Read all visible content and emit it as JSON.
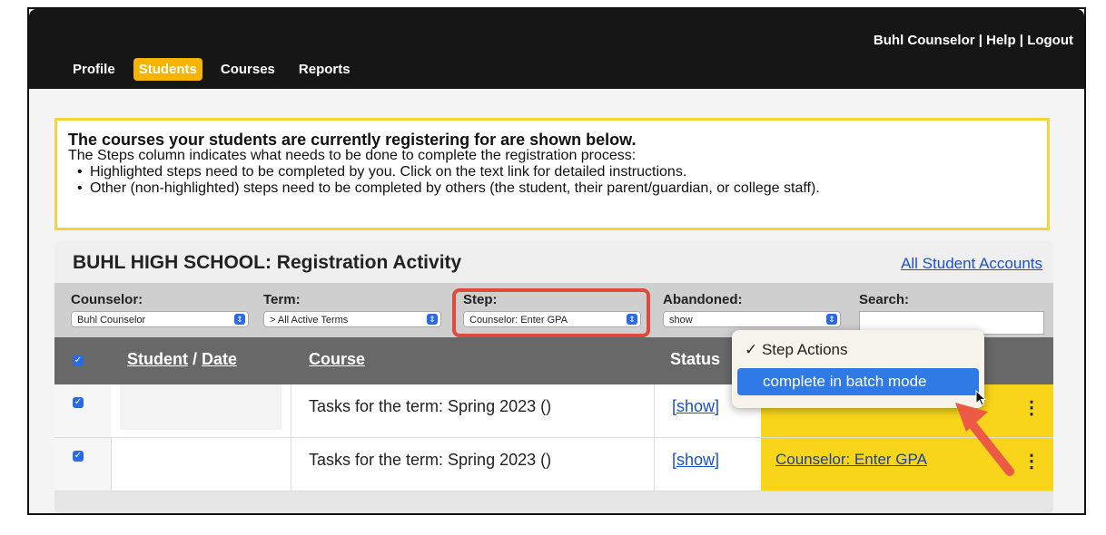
{
  "header": {
    "user_name": "Buhl Counselor",
    "separator": " | ",
    "help": "Help",
    "logout": "Logout"
  },
  "nav": {
    "tabs": [
      {
        "label": "Profile",
        "active": false
      },
      {
        "label": "Students",
        "active": true
      },
      {
        "label": "Courses",
        "active": false
      },
      {
        "label": "Reports",
        "active": false
      }
    ]
  },
  "notice": {
    "heading": "The courses your students are currently registering for are shown below.",
    "line1": "The Steps column indicates what needs to be done to complete the registration process:",
    "bullet1": "Highlighted steps need to be completed by you. Click on the text link for detailed instructions.",
    "bullet2": "Other (non-highlighted) steps need to be completed by others (the student, their parent/guardian, or college staff)."
  },
  "panel": {
    "title": "BUHL HIGH SCHOOL: Registration Activity",
    "all_accounts_link": "All Student Accounts"
  },
  "filters": {
    "counselor": {
      "label": "Counselor:",
      "value": "Buhl Counselor"
    },
    "term": {
      "label": "Term:",
      "value": "> All Active Terms"
    },
    "step": {
      "label": "Step:",
      "value": "Counselor: Enter GPA"
    },
    "abandoned": {
      "label": "Abandoned:",
      "value": "show"
    },
    "search": {
      "label": "Search:",
      "value": ""
    }
  },
  "table": {
    "headers": {
      "student": "Student",
      "slash": " / ",
      "date": "Date",
      "course": "Course",
      "status": "Status"
    },
    "rows": [
      {
        "course": "Tasks for the term: Spring 2023 ()",
        "status": "[show]",
        "step": ""
      },
      {
        "course": "Tasks for the term: Spring 2023 ()",
        "status": "[show]",
        "step": "Counselor: Enter GPA"
      }
    ]
  },
  "popup": {
    "item1": "✓ Step Actions",
    "item2": "complete in batch mode"
  },
  "colors": {
    "accent": "#f6b400",
    "highlight": "#f8d41a",
    "link": "#1a4fd6",
    "callout": "#e04a3c"
  }
}
